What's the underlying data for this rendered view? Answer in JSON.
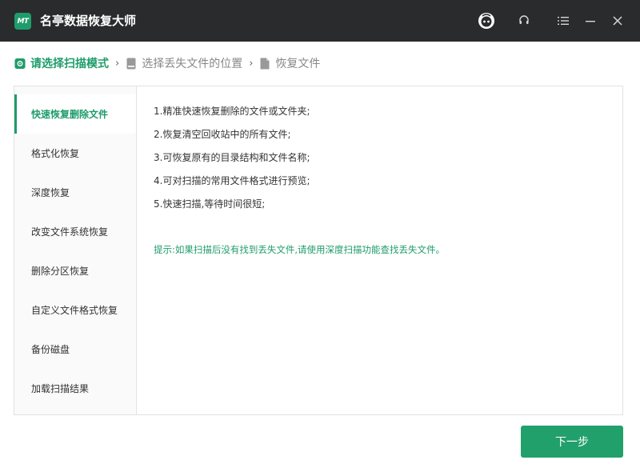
{
  "app": {
    "logo_text": "MT",
    "title": "名亭数据恢复大师"
  },
  "titlebar": {
    "icons": [
      "avatar-icon",
      "headset-icon",
      "menu-icon",
      "minimize-icon",
      "close-icon"
    ]
  },
  "breadcrumb": {
    "steps": [
      {
        "label": "请选择扫描模式",
        "state": "active"
      },
      {
        "label": "选择丢失文件的位置",
        "state": "inactive"
      },
      {
        "label": "恢复文件",
        "state": "inactive"
      }
    ],
    "separator": "›"
  },
  "sidebar": {
    "items": [
      {
        "label": "快速恢复删除文件",
        "active": true
      },
      {
        "label": "格式化恢复",
        "active": false
      },
      {
        "label": "深度恢复",
        "active": false
      },
      {
        "label": "改变文件系统恢复",
        "active": false
      },
      {
        "label": "删除分区恢复",
        "active": false
      },
      {
        "label": "自定义文件格式恢复",
        "active": false
      },
      {
        "label": "备份磁盘",
        "active": false
      },
      {
        "label": "加载扫描结果",
        "active": false
      }
    ]
  },
  "content": {
    "features": [
      "1.精准快速恢复删除的文件或文件夹;",
      "2.恢复清空回收站中的所有文件;",
      "3.可恢复原有的目录结构和文件名称;",
      "4.可对扫描的常用文件格式进行预览;",
      "5.快速扫描,等待时间很短;"
    ],
    "tip": "提示:如果扫描后没有找到丢失文件,请使用深度扫描功能查找丢失文件。"
  },
  "footer": {
    "next_label": "下一步"
  },
  "colors": {
    "accent": "#1f9c6b",
    "titlebar": "#2a2b2d"
  }
}
